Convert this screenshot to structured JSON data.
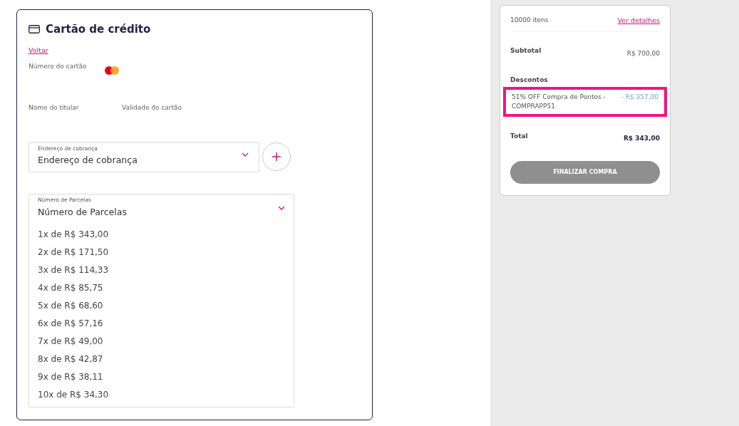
{
  "payment": {
    "title": "Cartão de crédito",
    "back_link": "Voltar",
    "card_number_label": "Número do cartão",
    "holder_label": "Nome do titular",
    "expiry_label": "Validade do cartão",
    "billing": {
      "label": "Endereço de cobrança",
      "value": "Endereço de cobrança"
    },
    "installments": {
      "label": "Número de Parcelas",
      "value": "Número de Parcelas",
      "expanded": true,
      "options": [
        {
          "text": "1x de R$ 343,00"
        },
        {
          "text": "2x de R$ 171,50"
        },
        {
          "text": "3x de R$ 114,33"
        },
        {
          "text": "4x de R$ 85,75"
        },
        {
          "text": "5x de R$ 68,60"
        },
        {
          "text": "6x de R$ 57,16"
        },
        {
          "text": "7x de R$ 49,00"
        },
        {
          "text": "8x de R$ 42,87"
        },
        {
          "text": "9x de R$ 38,11"
        },
        {
          "text": "10x de R$ 34,30"
        }
      ]
    }
  },
  "summary": {
    "items_count": "10000 itens",
    "details_link": "Ver detalhes",
    "subtotal_label": "Subtotal",
    "subtotal_value": "R$ 700,00",
    "discounts_label": "Descontos",
    "discounts": [
      {
        "name": "51% OFF Compra de Pontos - COMPRAPP51",
        "amount": "- R$ 357,00",
        "highlighted": true
      }
    ],
    "total_label": "Total",
    "total_value": "R$ 343,00",
    "checkout_button": {
      "label": "FINALIZAR COMPRA",
      "disabled": true
    }
  }
}
